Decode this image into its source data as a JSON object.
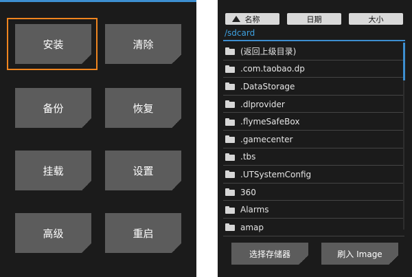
{
  "main_menu": {
    "buttons": [
      "安装",
      "清除",
      "备份",
      "恢复",
      "挂载",
      "设置",
      "高级",
      "重启"
    ],
    "selected": "安装",
    "selection_color": "#f0851f"
  },
  "file_browser": {
    "sort": {
      "name_label": "名称",
      "date_label": "日期",
      "size_label": "大小"
    },
    "current_path": "/sdcard",
    "items": [
      "(返回上级目录)",
      ".com.taobao.dp",
      ".DataStorage",
      ".dlprovider",
      ".flymeSafeBox",
      ".gamecenter",
      ".tbs",
      ".UTSystemConfig",
      "360",
      "Alarms",
      "amap"
    ],
    "select_storage_label": "选择存储器",
    "flash_image_label": "刷入 Image"
  },
  "colors": {
    "background": "#1b1b1b",
    "button": "#5c5c5c",
    "accent": "#3d8fd1",
    "selection": "#f0851f"
  }
}
